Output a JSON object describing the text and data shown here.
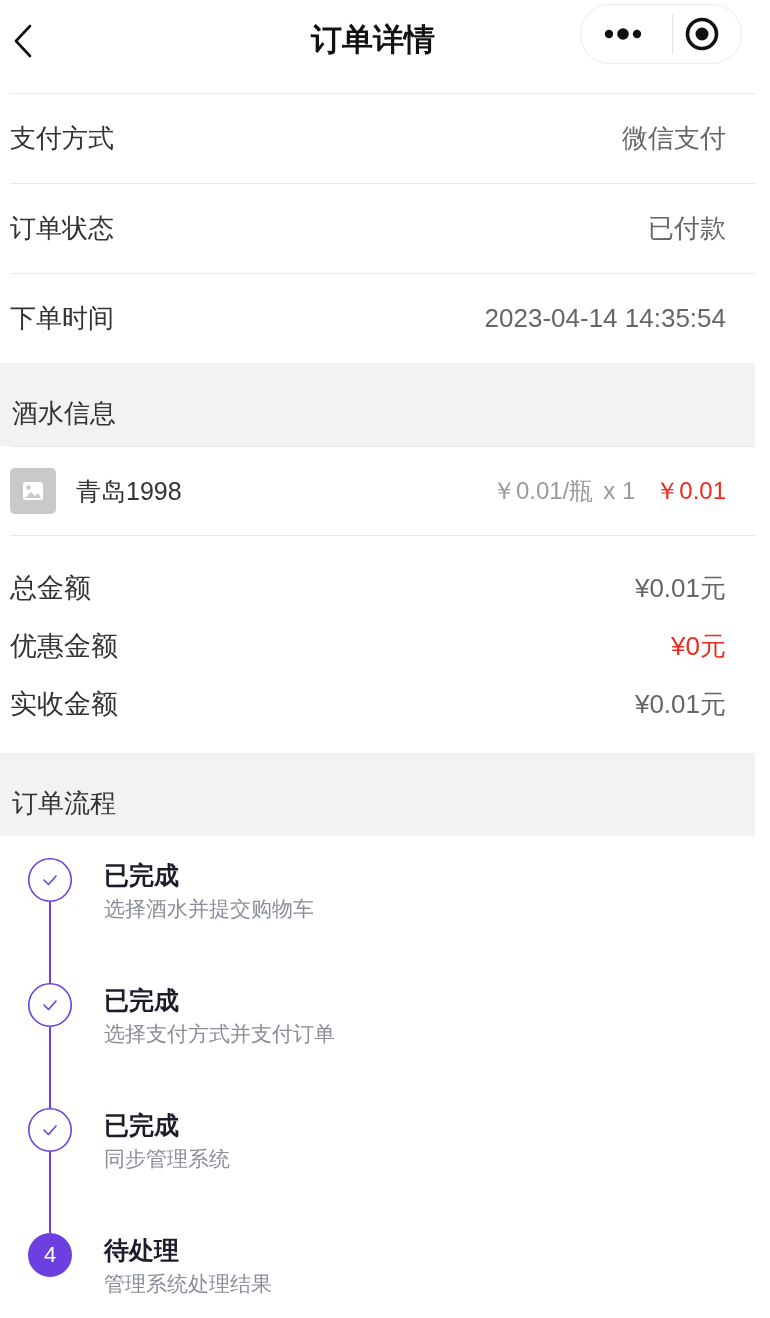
{
  "nav": {
    "title": "订单详情"
  },
  "order_info": [
    {
      "label": "支付方式",
      "value": "微信支付"
    },
    {
      "label": "订单状态",
      "value": "已付款"
    },
    {
      "label": "下单时间",
      "value": "2023-04-14 14:35:54"
    }
  ],
  "drinks": {
    "title": "酒水信息",
    "items": [
      {
        "name": "青岛1998",
        "unit_price": "￥0.01/瓶",
        "quantity": "x 1",
        "subtotal": "￥0.01"
      }
    ]
  },
  "totals": [
    {
      "label": "总金额",
      "value": "¥0.01元",
      "highlight": false
    },
    {
      "label": "优惠金额",
      "value": "¥0元",
      "highlight": true
    },
    {
      "label": "实收金额",
      "value": "¥0.01元",
      "highlight": false
    }
  ],
  "flow": {
    "title": "订单流程",
    "steps": [
      {
        "kind": "done",
        "status": "已完成",
        "description": "选择酒水并提交购物车"
      },
      {
        "kind": "done",
        "status": "已完成",
        "description": "选择支付方式并支付订单"
      },
      {
        "kind": "done",
        "status": "已完成",
        "description": "同步管理系统"
      },
      {
        "kind": "pending",
        "number": "4",
        "status": "待处理",
        "description": "管理系统处理结果"
      }
    ]
  }
}
